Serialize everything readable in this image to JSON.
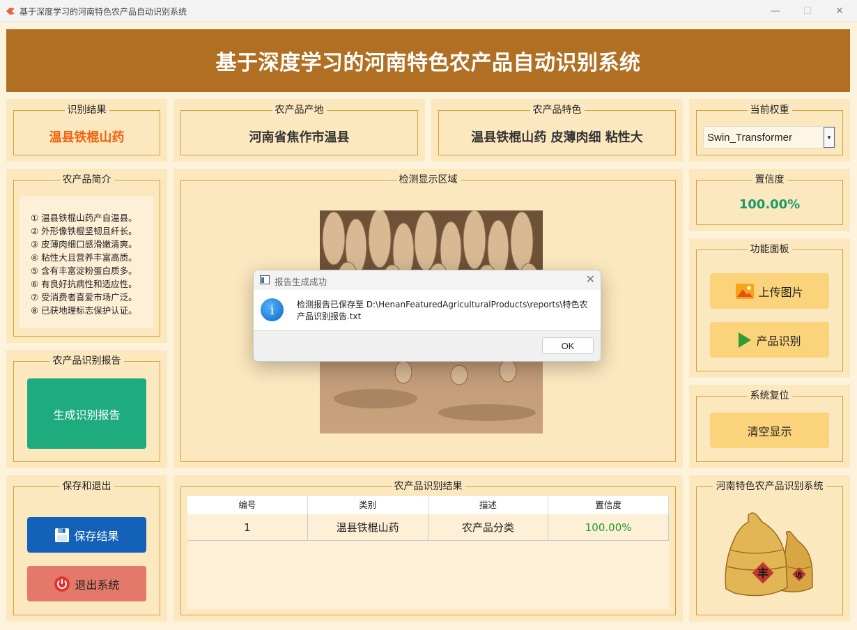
{
  "window": {
    "title": "基于深度学习的河南特色农产品自动识别系统",
    "minimize_glyph": "—",
    "maximize_glyph": "☐",
    "close_glyph": "✕"
  },
  "banner": {
    "title": "基于深度学习的河南特色农产品自动识别系统"
  },
  "recognition": {
    "label": "识别结果",
    "value": "温县铁棍山药",
    "value_color": "#f2620f"
  },
  "origin": {
    "label": "农产品产地",
    "value": "河南省焦作市温县"
  },
  "feature": {
    "label": "农产品特色",
    "value": "温县铁棍山药 皮薄肉细 粘性大"
  },
  "weight": {
    "label": "当前权重",
    "selected": "Swin_Transformer"
  },
  "intro": {
    "label": "农产品简介",
    "lines": [
      "① 温县铁棍山药产自温县。",
      "② 外形像铁棍坚韧且纤长。",
      "③ 皮薄肉细口感滑嫩清爽。",
      "④ 粘性大且营养丰富高质。",
      "⑤ 含有丰富淀粉蛋白质多。",
      "⑥ 有良好抗病性和适应性。",
      "⑦ 受消费者喜爱市场广泛。",
      "⑧ 已获地理标志保护认证。"
    ]
  },
  "detect": {
    "label": "检测显示区域"
  },
  "confidence": {
    "label": "置信度",
    "value": "100.00%",
    "value_color": "#1a9a6a"
  },
  "functions": {
    "label": "功能面板",
    "upload": "上传图片",
    "identify": "产品识别"
  },
  "report": {
    "label": "农产品识别报告",
    "button": "生成识别报告"
  },
  "reset": {
    "label": "系统复位",
    "button": "清空显示"
  },
  "save_exit": {
    "label": "保存和退出",
    "save": "保存结果",
    "exit": "退出系统"
  },
  "results": {
    "label": "农产品识别结果",
    "columns": [
      "编号",
      "类别",
      "描述",
      "置信度"
    ],
    "rows": [
      [
        "1",
        "温县铁棍山药",
        "农产品分类",
        "100.00%"
      ]
    ]
  },
  "logo": {
    "label": "河南特色农产品识别系统"
  },
  "dialog": {
    "title": "报告生成成功",
    "message": "检测报告已保存至 D:\\HenanFeaturedAgriculturalProducts\\reports\\特色农产品识别报告.txt",
    "ok": "OK",
    "close_glyph": "✕",
    "info_glyph": "i"
  }
}
